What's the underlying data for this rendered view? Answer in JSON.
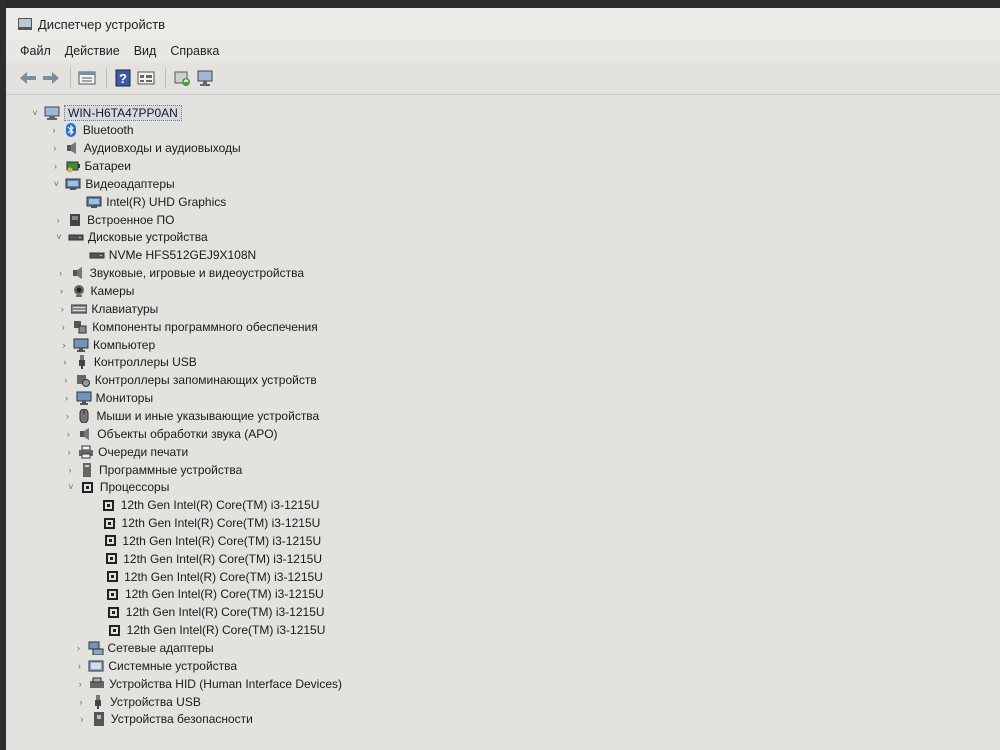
{
  "window": {
    "title": "Диспетчер устройств"
  },
  "menu": [
    "Файл",
    "Действие",
    "Вид",
    "Справка"
  ],
  "toolbar": [
    {
      "name": "back-icon",
      "label": "Назад"
    },
    {
      "name": "forward-icon",
      "label": "Вперёд"
    },
    {
      "name": "properties-icon",
      "label": "Свойства"
    },
    {
      "name": "help-icon",
      "label": "Справка"
    },
    {
      "name": "view-icon",
      "label": "Вид"
    },
    {
      "name": "update-driver-icon",
      "label": "Обновить драйвер"
    },
    {
      "name": "scan-hardware-icon",
      "label": "Обновить конфигурацию оборудования"
    }
  ],
  "tree": {
    "root": "WIN-H6TA47PP0AN",
    "categories": [
      {
        "label": "Bluetooth",
        "icon": "bluetooth-icon",
        "expanded": false,
        "children": []
      },
      {
        "label": "Аудиовходы и аудиовыходы",
        "icon": "speaker-icon",
        "expanded": false,
        "children": []
      },
      {
        "label": "Батареи",
        "icon": "battery-icon",
        "expanded": false,
        "children": []
      },
      {
        "label": "Видеоадаптеры",
        "icon": "display-adapter-icon",
        "expanded": true,
        "children": [
          "Intel(R) UHD Graphics"
        ]
      },
      {
        "label": "Встроенное ПО",
        "icon": "firmware-icon",
        "expanded": false,
        "children": []
      },
      {
        "label": "Дисковые устройства",
        "icon": "disk-icon",
        "expanded": true,
        "children": [
          "NVMe HFS512GEJ9X108N"
        ]
      },
      {
        "label": "Звуковые, игровые и видеоустройства",
        "icon": "sound-icon",
        "expanded": false,
        "children": []
      },
      {
        "label": "Камеры",
        "icon": "camera-icon",
        "expanded": false,
        "children": []
      },
      {
        "label": "Клавиатуры",
        "icon": "keyboard-icon",
        "expanded": false,
        "children": []
      },
      {
        "label": "Компоненты программного обеспечения",
        "icon": "software-component-icon",
        "expanded": false,
        "children": []
      },
      {
        "label": "Компьютер",
        "icon": "computer-icon",
        "expanded": false,
        "children": []
      },
      {
        "label": "Контроллеры USB",
        "icon": "usb-controller-icon",
        "expanded": false,
        "children": []
      },
      {
        "label": "Контроллеры запоминающих устройств",
        "icon": "storage-controller-icon",
        "expanded": false,
        "children": []
      },
      {
        "label": "Мониторы",
        "icon": "monitor-icon",
        "expanded": false,
        "children": []
      },
      {
        "label": "Мыши и иные указывающие устройства",
        "icon": "mouse-icon",
        "expanded": false,
        "children": []
      },
      {
        "label": "Объекты обработки звука (APO)",
        "icon": "audio-processing-icon",
        "expanded": false,
        "children": []
      },
      {
        "label": "Очереди печати",
        "icon": "printer-icon",
        "expanded": false,
        "children": []
      },
      {
        "label": "Программные устройства",
        "icon": "software-device-icon",
        "expanded": false,
        "children": []
      },
      {
        "label": "Процессоры",
        "icon": "processor-icon",
        "expanded": true,
        "children": [
          "12th Gen Intel(R) Core(TM) i3-1215U",
          "12th Gen Intel(R) Core(TM) i3-1215U",
          "12th Gen Intel(R) Core(TM) i3-1215U",
          "12th Gen Intel(R) Core(TM) i3-1215U",
          "12th Gen Intel(R) Core(TM) i3-1215U",
          "12th Gen Intel(R) Core(TM) i3-1215U",
          "12th Gen Intel(R) Core(TM) i3-1215U",
          "12th Gen Intel(R) Core(TM) i3-1215U"
        ]
      },
      {
        "label": "Сетевые адаптеры",
        "icon": "network-adapter-icon",
        "expanded": false,
        "children": []
      },
      {
        "label": "Системные устройства",
        "icon": "system-device-icon",
        "expanded": false,
        "children": []
      },
      {
        "label": "Устройства HID (Human Interface Devices)",
        "icon": "hid-icon",
        "expanded": false,
        "children": []
      },
      {
        "label": "Устройства USB",
        "icon": "usb-device-icon",
        "expanded": false,
        "children": []
      },
      {
        "label": "Устройства безопасности",
        "icon": "security-device-icon",
        "expanded": false,
        "children": []
      }
    ]
  },
  "colors": {
    "bluetooth": "#1e6fd9",
    "selection": "#d6dbe3"
  }
}
